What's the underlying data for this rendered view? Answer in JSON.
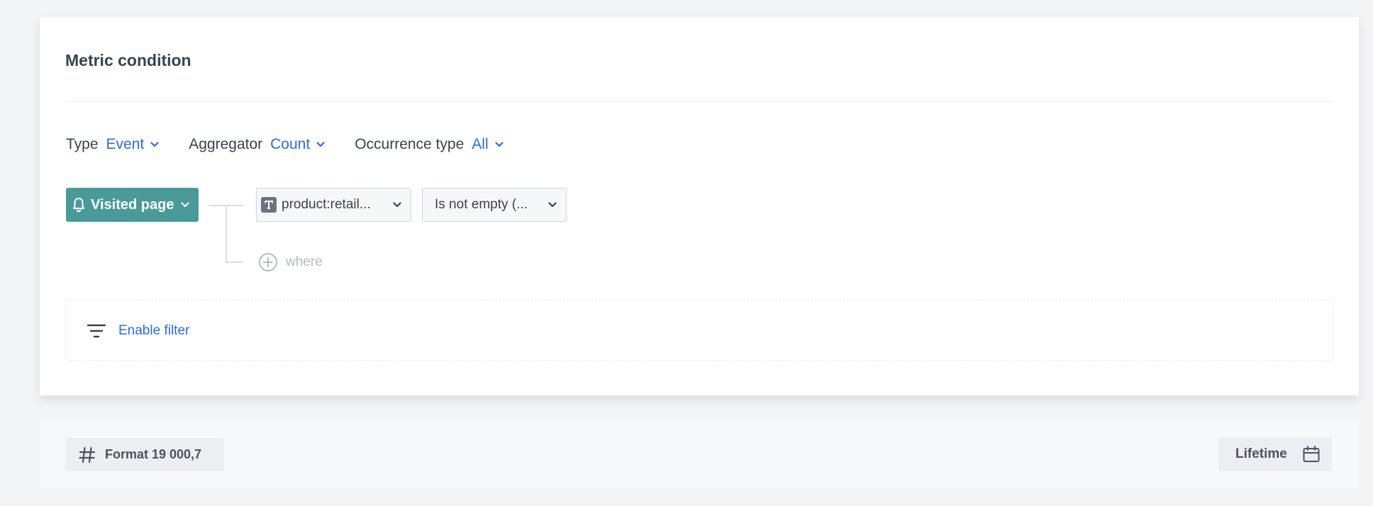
{
  "card": {
    "title": "Metric condition"
  },
  "selectors": {
    "type": {
      "label": "Type",
      "value": "Event"
    },
    "aggregator": {
      "label": "Aggregator",
      "value": "Count"
    },
    "occurrence": {
      "label": "Occurrence type",
      "value": "All"
    }
  },
  "event": {
    "label": "Visited page",
    "icon": "bell-icon"
  },
  "parameter": {
    "value": "product:retail...",
    "icon": "text-type-icon"
  },
  "operator": {
    "value": "Is not empty (..."
  },
  "where": {
    "label": "where",
    "icon": "plus-circle-icon"
  },
  "filter": {
    "label": "Enable filter",
    "icon": "filter-icon"
  },
  "footer": {
    "format_label": "Format 19 000,7",
    "format_icon": "hash-icon",
    "period_label": "Lifetime",
    "period_icon": "calendar-icon"
  },
  "colors": {
    "accent": "#2b6bdf",
    "event_button": "#4a9a9a",
    "text": "#384350",
    "muted": "#b4bbc4"
  }
}
